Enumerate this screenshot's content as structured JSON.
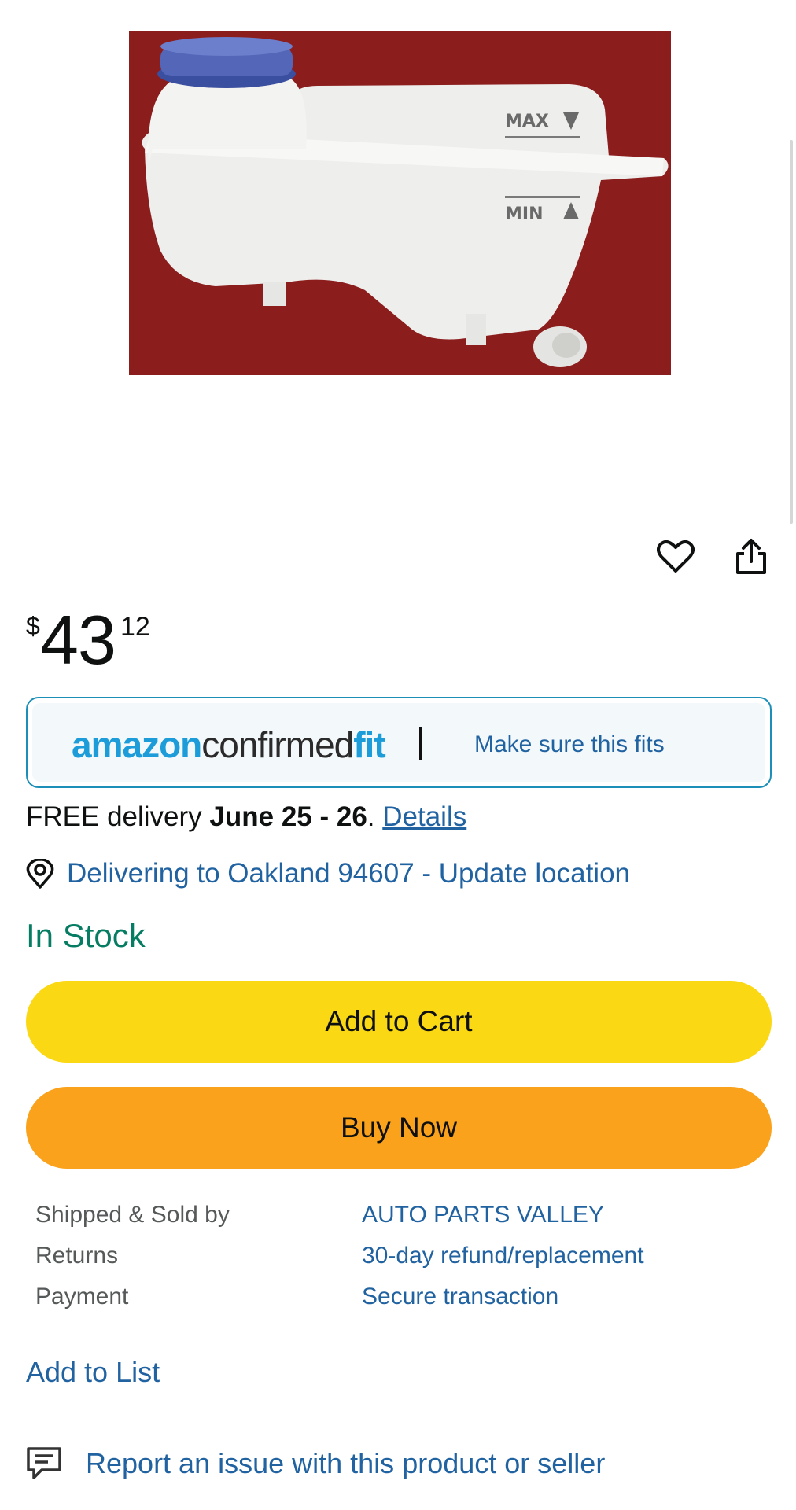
{
  "product": {
    "image_alt": "coolant reservoir",
    "image_labels": {
      "max": "MAX",
      "min": "MIN"
    }
  },
  "price": {
    "currency": "$",
    "whole": "43",
    "fraction": "12"
  },
  "confirmed_fit": {
    "logo": {
      "part1": "amazon",
      "part2": "confirmed",
      "part3": "fit"
    },
    "link": "Make sure this fits"
  },
  "delivery": {
    "prefix": "FREE delivery ",
    "dates": "June 25 - 26",
    "punct": ". ",
    "details_link": "Details"
  },
  "location": {
    "text": "Delivering to Oakland 94607 - Update location"
  },
  "stock": {
    "status": "In Stock",
    "color": "#067d62"
  },
  "buttons": {
    "add_to_cart": "Add to Cart",
    "buy_now": "Buy Now",
    "add_to_cart_color": "#fbd814",
    "buy_now_color": "#fba21c"
  },
  "info": [
    {
      "label": "Shipped & Sold by",
      "value": "AUTO PARTS VALLEY"
    },
    {
      "label": "Returns",
      "value": "30-day refund/replacement"
    },
    {
      "label": "Payment",
      "value": "Secure transaction"
    }
  ],
  "add_to_list": "Add to List",
  "report": "Report an issue with this product or seller",
  "icons": [
    "heart-icon",
    "share-icon",
    "location-pin-icon",
    "report-icon"
  ]
}
